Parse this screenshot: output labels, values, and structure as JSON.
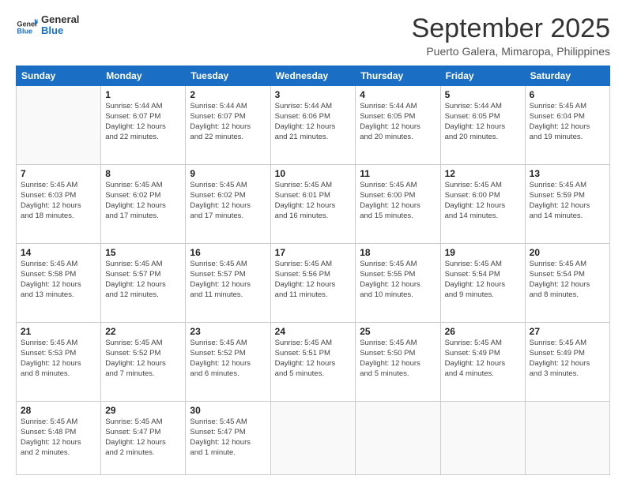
{
  "header": {
    "logo_general": "General",
    "logo_blue": "Blue",
    "month": "September 2025",
    "location": "Puerto Galera, Mimaropa, Philippines"
  },
  "days_of_week": [
    "Sunday",
    "Monday",
    "Tuesday",
    "Wednesday",
    "Thursday",
    "Friday",
    "Saturday"
  ],
  "weeks": [
    [
      {
        "day": "",
        "text": ""
      },
      {
        "day": "1",
        "text": "Sunrise: 5:44 AM\nSunset: 6:07 PM\nDaylight: 12 hours\nand 22 minutes."
      },
      {
        "day": "2",
        "text": "Sunrise: 5:44 AM\nSunset: 6:07 PM\nDaylight: 12 hours\nand 22 minutes."
      },
      {
        "day": "3",
        "text": "Sunrise: 5:44 AM\nSunset: 6:06 PM\nDaylight: 12 hours\nand 21 minutes."
      },
      {
        "day": "4",
        "text": "Sunrise: 5:44 AM\nSunset: 6:05 PM\nDaylight: 12 hours\nand 20 minutes."
      },
      {
        "day": "5",
        "text": "Sunrise: 5:44 AM\nSunset: 6:05 PM\nDaylight: 12 hours\nand 20 minutes."
      },
      {
        "day": "6",
        "text": "Sunrise: 5:45 AM\nSunset: 6:04 PM\nDaylight: 12 hours\nand 19 minutes."
      }
    ],
    [
      {
        "day": "7",
        "text": "Sunrise: 5:45 AM\nSunset: 6:03 PM\nDaylight: 12 hours\nand 18 minutes."
      },
      {
        "day": "8",
        "text": "Sunrise: 5:45 AM\nSunset: 6:02 PM\nDaylight: 12 hours\nand 17 minutes."
      },
      {
        "day": "9",
        "text": "Sunrise: 5:45 AM\nSunset: 6:02 PM\nDaylight: 12 hours\nand 17 minutes."
      },
      {
        "day": "10",
        "text": "Sunrise: 5:45 AM\nSunset: 6:01 PM\nDaylight: 12 hours\nand 16 minutes."
      },
      {
        "day": "11",
        "text": "Sunrise: 5:45 AM\nSunset: 6:00 PM\nDaylight: 12 hours\nand 15 minutes."
      },
      {
        "day": "12",
        "text": "Sunrise: 5:45 AM\nSunset: 6:00 PM\nDaylight: 12 hours\nand 14 minutes."
      },
      {
        "day": "13",
        "text": "Sunrise: 5:45 AM\nSunset: 5:59 PM\nDaylight: 12 hours\nand 14 minutes."
      }
    ],
    [
      {
        "day": "14",
        "text": "Sunrise: 5:45 AM\nSunset: 5:58 PM\nDaylight: 12 hours\nand 13 minutes."
      },
      {
        "day": "15",
        "text": "Sunrise: 5:45 AM\nSunset: 5:57 PM\nDaylight: 12 hours\nand 12 minutes."
      },
      {
        "day": "16",
        "text": "Sunrise: 5:45 AM\nSunset: 5:57 PM\nDaylight: 12 hours\nand 11 minutes."
      },
      {
        "day": "17",
        "text": "Sunrise: 5:45 AM\nSunset: 5:56 PM\nDaylight: 12 hours\nand 11 minutes."
      },
      {
        "day": "18",
        "text": "Sunrise: 5:45 AM\nSunset: 5:55 PM\nDaylight: 12 hours\nand 10 minutes."
      },
      {
        "day": "19",
        "text": "Sunrise: 5:45 AM\nSunset: 5:54 PM\nDaylight: 12 hours\nand 9 minutes."
      },
      {
        "day": "20",
        "text": "Sunrise: 5:45 AM\nSunset: 5:54 PM\nDaylight: 12 hours\nand 8 minutes."
      }
    ],
    [
      {
        "day": "21",
        "text": "Sunrise: 5:45 AM\nSunset: 5:53 PM\nDaylight: 12 hours\nand 8 minutes."
      },
      {
        "day": "22",
        "text": "Sunrise: 5:45 AM\nSunset: 5:52 PM\nDaylight: 12 hours\nand 7 minutes."
      },
      {
        "day": "23",
        "text": "Sunrise: 5:45 AM\nSunset: 5:52 PM\nDaylight: 12 hours\nand 6 minutes."
      },
      {
        "day": "24",
        "text": "Sunrise: 5:45 AM\nSunset: 5:51 PM\nDaylight: 12 hours\nand 5 minutes."
      },
      {
        "day": "25",
        "text": "Sunrise: 5:45 AM\nSunset: 5:50 PM\nDaylight: 12 hours\nand 5 minutes."
      },
      {
        "day": "26",
        "text": "Sunrise: 5:45 AM\nSunset: 5:49 PM\nDaylight: 12 hours\nand 4 minutes."
      },
      {
        "day": "27",
        "text": "Sunrise: 5:45 AM\nSunset: 5:49 PM\nDaylight: 12 hours\nand 3 minutes."
      }
    ],
    [
      {
        "day": "28",
        "text": "Sunrise: 5:45 AM\nSunset: 5:48 PM\nDaylight: 12 hours\nand 2 minutes."
      },
      {
        "day": "29",
        "text": "Sunrise: 5:45 AM\nSunset: 5:47 PM\nDaylight: 12 hours\nand 2 minutes."
      },
      {
        "day": "30",
        "text": "Sunrise: 5:45 AM\nSunset: 5:47 PM\nDaylight: 12 hours\nand 1 minute."
      },
      {
        "day": "",
        "text": ""
      },
      {
        "day": "",
        "text": ""
      },
      {
        "day": "",
        "text": ""
      },
      {
        "day": "",
        "text": ""
      }
    ]
  ]
}
